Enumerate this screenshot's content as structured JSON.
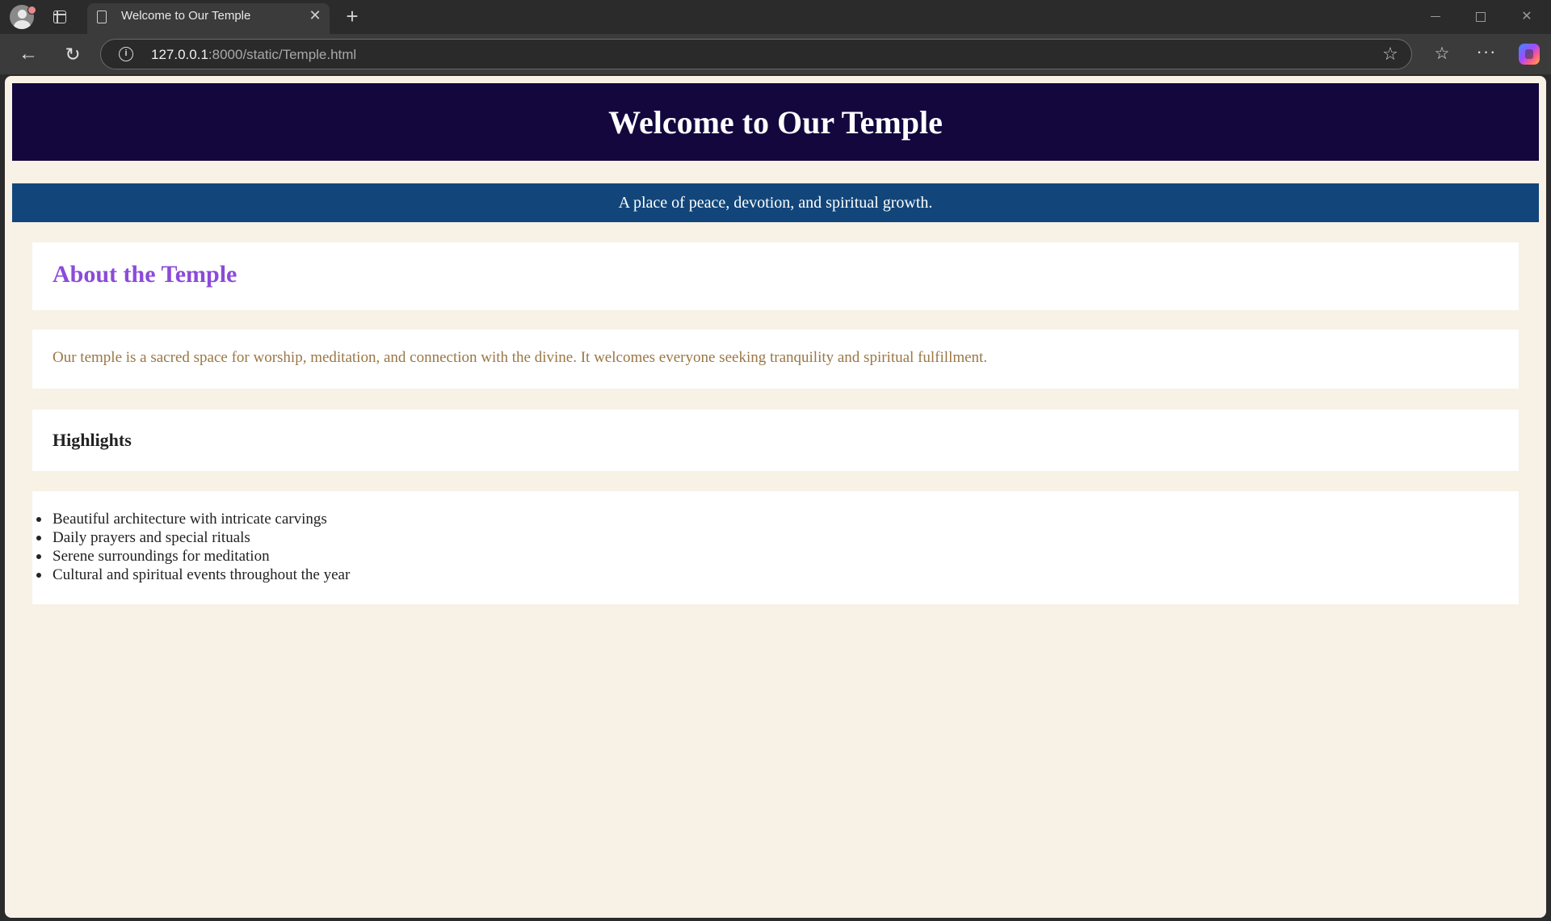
{
  "browser": {
    "tab_title": "Welcome to Our Temple",
    "tab_close": "✕",
    "new_tab": "+",
    "url_host": "127.0.0.1",
    "url_path": ":8000/static/Temple.html",
    "info_icon": "i",
    "icons": [
      "profile-icon",
      "tab-actions-icon",
      "page-icon",
      "close-icon",
      "new-tab-icon",
      "back-icon",
      "reload-icon",
      "info-icon",
      "star-icon",
      "favorites-icon",
      "more-icon",
      "copilot-icon"
    ]
  },
  "page": {
    "header": {
      "title": "Welcome to Our Temple"
    },
    "tagline": "A place of peace, devotion, and spiritual growth.",
    "about": {
      "title": "About the Temple",
      "description": "Our temple is a sacred space for worship, meditation, and connection with the divine. It welcomes everyone seeking tranquility and spiritual fulfillment."
    },
    "highlights": {
      "title": "Highlights",
      "items": [
        "Beautiful architecture with intricate carvings",
        "Daily prayers and special rituals",
        "Serene surroundings for meditation",
        "Cultural and spiritual events throughout the year"
      ]
    }
  },
  "colors": {
    "page_background": "#f8f1e6",
    "header_background": "#13073e",
    "tagline_background": "#12467a",
    "about_title": "#8b4bd9",
    "description_text": "#9a7746"
  }
}
